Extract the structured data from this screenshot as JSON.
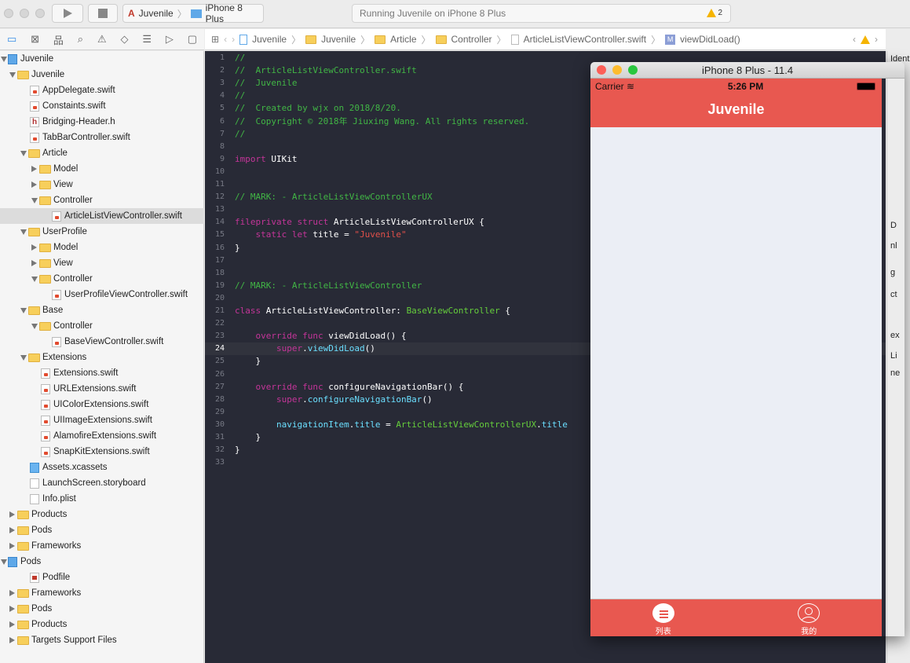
{
  "toolbar": {
    "scheme": "Juvenile",
    "device": "iPhone 8 Plus",
    "status": "Running Juvenile on iPhone 8 Plus",
    "warning_count": "2"
  },
  "jumpbar": [
    "Juvenile",
    "Juvenile",
    "Article",
    "Controller",
    "ArticleListViewController.swift",
    "viewDidLoad()"
  ],
  "navigator_icons": [
    "folder-icon",
    "source-control-icon",
    "hierarchy-icon",
    "search-icon",
    "warning-icon",
    "breakpoint-icon",
    "report-icon",
    "tag-icon",
    "comment-icon"
  ],
  "tree": [
    {
      "l": 0,
      "t": "proj",
      "d": "open",
      "label": "Juvenile"
    },
    {
      "l": 1,
      "t": "folder",
      "d": "open",
      "label": "Juvenile"
    },
    {
      "l": 2,
      "t": "swift",
      "label": "AppDelegate.swift"
    },
    {
      "l": 2,
      "t": "swift",
      "label": "Constaints.swift"
    },
    {
      "l": 2,
      "t": "h",
      "label": "Bridging-Header.h"
    },
    {
      "l": 2,
      "t": "swift",
      "label": "TabBarController.swift"
    },
    {
      "l": 2,
      "t": "folder",
      "d": "open",
      "label": "Article"
    },
    {
      "l": 3,
      "t": "folder",
      "d": "closed",
      "label": "Model"
    },
    {
      "l": 3,
      "t": "folder",
      "d": "closed",
      "label": "View"
    },
    {
      "l": 3,
      "t": "folder",
      "d": "open",
      "label": "Controller"
    },
    {
      "l": 4,
      "t": "swift",
      "label": "ArticleListViewController.swift",
      "sel": true
    },
    {
      "l": 2,
      "t": "folder",
      "d": "open",
      "label": "UserProfile"
    },
    {
      "l": 3,
      "t": "folder",
      "d": "closed",
      "label": "Model"
    },
    {
      "l": 3,
      "t": "folder",
      "d": "closed",
      "label": "View"
    },
    {
      "l": 3,
      "t": "folder",
      "d": "open",
      "label": "Controller"
    },
    {
      "l": 4,
      "t": "swift",
      "label": "UserProfileViewController.swift"
    },
    {
      "l": 2,
      "t": "folder",
      "d": "open",
      "label": "Base"
    },
    {
      "l": 3,
      "t": "folder",
      "d": "open",
      "label": "Controller"
    },
    {
      "l": 4,
      "t": "swift",
      "label": "BaseViewController.swift"
    },
    {
      "l": 2,
      "t": "folder",
      "d": "open",
      "label": "Extensions"
    },
    {
      "l": 3,
      "t": "swift",
      "label": "Extensions.swift"
    },
    {
      "l": 3,
      "t": "swift",
      "label": "URLExtensions.swift"
    },
    {
      "l": 3,
      "t": "swift",
      "label": "UIColorExtensions.swift"
    },
    {
      "l": 3,
      "t": "swift",
      "label": "UIImageExtensions.swift"
    },
    {
      "l": 3,
      "t": "swift",
      "label": "AlamofireExtensions.swift"
    },
    {
      "l": 3,
      "t": "swift",
      "label": "SnapKitExtensions.swift"
    },
    {
      "l": 2,
      "t": "assets",
      "label": "Assets.xcassets"
    },
    {
      "l": 2,
      "t": "plain",
      "label": "LaunchScreen.storyboard"
    },
    {
      "l": 2,
      "t": "plain",
      "label": "Info.plist"
    },
    {
      "l": 1,
      "t": "folder",
      "d": "closed",
      "label": "Products"
    },
    {
      "l": 1,
      "t": "folder",
      "d": "closed",
      "label": "Pods"
    },
    {
      "l": 1,
      "t": "folder",
      "d": "closed",
      "label": "Frameworks"
    },
    {
      "l": 0,
      "t": "proj",
      "d": "open",
      "label": "Pods"
    },
    {
      "l": 2,
      "t": "pod",
      "label": "Podfile"
    },
    {
      "l": 1,
      "t": "folder",
      "d": "closed",
      "label": "Frameworks"
    },
    {
      "l": 1,
      "t": "folder",
      "d": "closed",
      "label": "Pods"
    },
    {
      "l": 1,
      "t": "folder",
      "d": "closed",
      "label": "Products"
    },
    {
      "l": 1,
      "t": "folder",
      "d": "closed",
      "label": "Targets Support Files"
    }
  ],
  "code": {
    "current_line": 24,
    "lines": [
      [
        [
          "c",
          "//"
        ]
      ],
      [
        [
          "c",
          "//  ArticleListViewController.swift"
        ]
      ],
      [
        [
          "c",
          "//  Juvenile"
        ]
      ],
      [
        [
          "c",
          "//"
        ]
      ],
      [
        [
          "c",
          "//  Created by wjx on 2018/8/20."
        ]
      ],
      [
        [
          "c",
          "//  Copyright © 2018年 Jiuxing Wang. All rights reserved."
        ]
      ],
      [
        [
          "c",
          "//"
        ]
      ],
      [],
      [
        [
          "k",
          "import"
        ],
        [
          "p",
          " UIKit"
        ]
      ],
      [],
      [],
      [
        [
          "c",
          "// MARK: - ArticleListViewControllerUX"
        ]
      ],
      [],
      [
        [
          "k",
          "fileprivate struct"
        ],
        [
          "p",
          " ArticleListViewControllerUX {"
        ]
      ],
      [
        [
          "p",
          "    "
        ],
        [
          "k",
          "static let"
        ],
        [
          "p",
          " title = "
        ],
        [
          "s",
          "\"Juvenile\""
        ]
      ],
      [
        [
          "p",
          "}"
        ]
      ],
      [],
      [],
      [
        [
          "c",
          "// MARK: - ArticleListViewController"
        ]
      ],
      [],
      [
        [
          "k",
          "class"
        ],
        [
          "p",
          " ArticleListViewController: "
        ],
        [
          "f",
          "BaseViewController"
        ],
        [
          "p",
          " {"
        ]
      ],
      [],
      [
        [
          "p",
          "    "
        ],
        [
          "k",
          "override func"
        ],
        [
          "p",
          " viewDidLoad() {"
        ]
      ],
      [
        [
          "p",
          "        "
        ],
        [
          "k",
          "super"
        ],
        [
          "p",
          "."
        ],
        [
          "t",
          "viewDidLoad"
        ],
        [
          "p",
          "()"
        ]
      ],
      [
        [
          "p",
          "    }"
        ]
      ],
      [],
      [
        [
          "p",
          "    "
        ],
        [
          "k",
          "override func"
        ],
        [
          "p",
          " configureNavigationBar() {"
        ]
      ],
      [
        [
          "p",
          "        "
        ],
        [
          "k",
          "super"
        ],
        [
          "p",
          "."
        ],
        [
          "t",
          "configureNavigationBar"
        ],
        [
          "p",
          "()"
        ]
      ],
      [],
      [
        [
          "p",
          "        "
        ],
        [
          "t",
          "navigationItem"
        ],
        [
          "p",
          "."
        ],
        [
          "t",
          "title"
        ],
        [
          "p",
          " = "
        ],
        [
          "f",
          "ArticleListViewControllerUX"
        ],
        [
          "p",
          "."
        ],
        [
          "t",
          "title"
        ]
      ],
      [
        [
          "p",
          "    }"
        ]
      ],
      [
        [
          "p",
          "}"
        ]
      ],
      []
    ]
  },
  "inspector": [
    "Ident",
    "D",
    "nl",
    "g",
    "ct",
    "ex",
    "Li",
    "ne"
  ],
  "simulator": {
    "title": "iPhone 8 Plus - 11.4",
    "carrier": "Carrier",
    "time": "5:26 PM",
    "nav_title": "Juvenile",
    "tabs": [
      {
        "label": "列表",
        "icon": "list-icon",
        "selected": true
      },
      {
        "label": "我的",
        "icon": "profile-icon",
        "selected": false
      }
    ],
    "accent": "#e85850"
  }
}
